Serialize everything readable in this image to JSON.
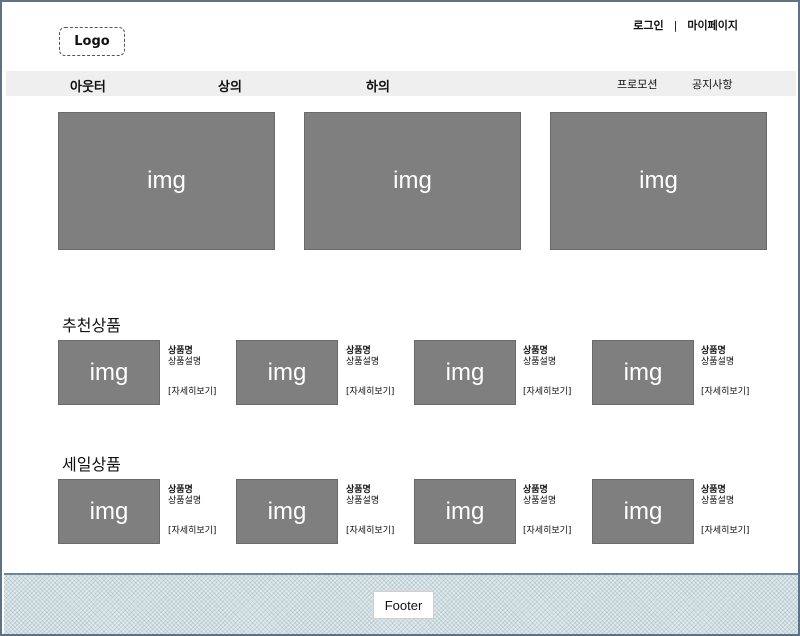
{
  "header": {
    "logo": "Logo",
    "login": "로그인",
    "separator": "|",
    "mypage": "마이페이지"
  },
  "nav": {
    "items": [
      "아웃터",
      "상의",
      "하의"
    ],
    "sub_items": [
      "프로모션",
      "공지사항"
    ]
  },
  "banners": [
    "img",
    "img",
    "img"
  ],
  "recommended": {
    "title": "추천상품",
    "products": [
      {
        "img": "img",
        "name": "상품명",
        "desc": "상품설명",
        "more": "[자세히보기]"
      },
      {
        "img": "img",
        "name": "상품명",
        "desc": "상품설명",
        "more": "[자세히보기]"
      },
      {
        "img": "img",
        "name": "상품명",
        "desc": "상품설명",
        "more": "[자세히보기]"
      },
      {
        "img": "img",
        "name": "상품명",
        "desc": "상품설명",
        "more": "[자세히보기]"
      }
    ]
  },
  "sale": {
    "title": "세일상품",
    "products": [
      {
        "img": "img",
        "name": "상품명",
        "desc": "상품설명",
        "more": "[자세히보기]"
      },
      {
        "img": "img",
        "name": "상품명",
        "desc": "상품설명",
        "more": "[자세히보기]"
      },
      {
        "img": "img",
        "name": "상품명",
        "desc": "상품설명",
        "more": "[자세히보기]"
      },
      {
        "img": "img",
        "name": "상품명",
        "desc": "상품설명",
        "more": "[자세히보기]"
      }
    ]
  },
  "footer": {
    "label": "Footer"
  },
  "colors": {
    "placeholder": "#7f7f7f",
    "nav_bg": "#efefef",
    "footer_bg": "#dfe9ec",
    "frame_border": "#5d7284"
  }
}
